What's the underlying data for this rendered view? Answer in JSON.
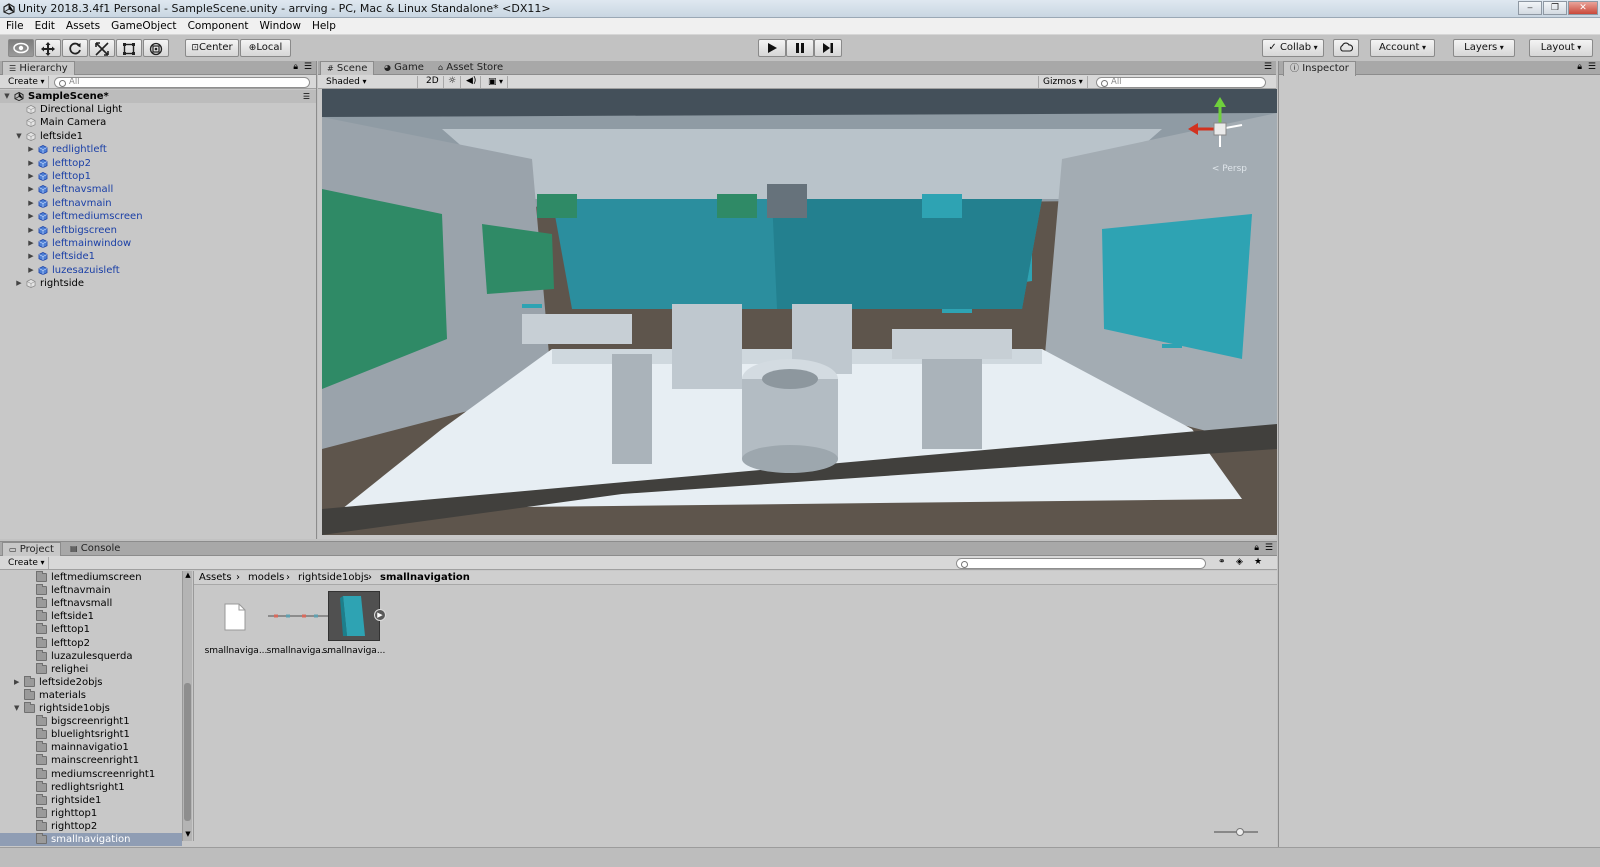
{
  "window": {
    "title": "Unity 2018.3.4f1 Personal - SampleScene.unity - arrving - PC, Mac & Linux Standalone* <DX11>",
    "controls": [
      "‒",
      "❐",
      "✕"
    ]
  },
  "menu": [
    "File",
    "Edit",
    "Assets",
    "GameObject",
    "Component",
    "Window",
    "Help"
  ],
  "toolbar": {
    "pivot": "Center",
    "space": "Local",
    "collab": "Collab",
    "account": "Account",
    "layers": "Layers",
    "layout": "Layout"
  },
  "hierarchy": {
    "tab": "Hierarchy",
    "create": "Create",
    "search_placeholder": "All",
    "scene": "SampleScene*",
    "items": [
      {
        "label": "Directional Light",
        "depth": 1,
        "arrow": "",
        "prefab": false
      },
      {
        "label": "Main Camera",
        "depth": 1,
        "arrow": "",
        "prefab": false
      },
      {
        "label": "leftside1",
        "depth": 1,
        "arrow": "▼",
        "prefab": false
      },
      {
        "label": "redlightleft",
        "depth": 2,
        "arrow": "▶",
        "prefab": true
      },
      {
        "label": "lefttop2",
        "depth": 2,
        "arrow": "▶",
        "prefab": true
      },
      {
        "label": "lefttop1",
        "depth": 2,
        "arrow": "▶",
        "prefab": true
      },
      {
        "label": "leftnavsmall",
        "depth": 2,
        "arrow": "▶",
        "prefab": true
      },
      {
        "label": "leftnavmain",
        "depth": 2,
        "arrow": "▶",
        "prefab": true
      },
      {
        "label": "leftmediumscreen",
        "depth": 2,
        "arrow": "▶",
        "prefab": true
      },
      {
        "label": "leftbigscreen",
        "depth": 2,
        "arrow": "▶",
        "prefab": true
      },
      {
        "label": "leftmainwindow",
        "depth": 2,
        "arrow": "▶",
        "prefab": true
      },
      {
        "label": "leftside1",
        "depth": 2,
        "arrow": "▶",
        "prefab": true
      },
      {
        "label": "luzesazuisleft",
        "depth": 2,
        "arrow": "▶",
        "prefab": true
      },
      {
        "label": "rightside",
        "depth": 1,
        "arrow": "▶",
        "prefab": false
      }
    ]
  },
  "scene": {
    "tabs": [
      "Scene",
      "Game",
      "Asset Store"
    ],
    "shading": "Shaded",
    "mode2d": "2D",
    "gizmos": "Gizmos",
    "search_placeholder": "All",
    "persp": "< Persp"
  },
  "inspector": {
    "tab": "Inspector"
  },
  "project": {
    "tabs": [
      "Project",
      "Console"
    ],
    "create": "Create",
    "breadcrumb": [
      "Assets",
      "models",
      "rightside1objs",
      "smallnavigation"
    ],
    "tree": [
      {
        "label": "leftmediumscreen",
        "depth": 3,
        "arrow": ""
      },
      {
        "label": "leftnavmain",
        "depth": 3,
        "arrow": ""
      },
      {
        "label": "leftnavsmall",
        "depth": 3,
        "arrow": ""
      },
      {
        "label": "leftside1",
        "depth": 3,
        "arrow": ""
      },
      {
        "label": "lefttop1",
        "depth": 3,
        "arrow": ""
      },
      {
        "label": "lefttop2",
        "depth": 3,
        "arrow": ""
      },
      {
        "label": "luzazulesquerda",
        "depth": 3,
        "arrow": ""
      },
      {
        "label": "relighei",
        "depth": 3,
        "arrow": ""
      },
      {
        "label": "leftside2objs",
        "depth": 2,
        "arrow": "▶"
      },
      {
        "label": "materials",
        "depth": 2,
        "arrow": ""
      },
      {
        "label": "rightside1objs",
        "depth": 2,
        "arrow": "▼"
      },
      {
        "label": "bigscreenright1",
        "depth": 3,
        "arrow": ""
      },
      {
        "label": "bluelightsright1",
        "depth": 3,
        "arrow": ""
      },
      {
        "label": "mainnavigatio1",
        "depth": 3,
        "arrow": ""
      },
      {
        "label": "mainscreenright1",
        "depth": 3,
        "arrow": ""
      },
      {
        "label": "mediumscreenright1",
        "depth": 3,
        "arrow": ""
      },
      {
        "label": "redlightsright1",
        "depth": 3,
        "arrow": ""
      },
      {
        "label": "rightside1",
        "depth": 3,
        "arrow": ""
      },
      {
        "label": "righttop1",
        "depth": 3,
        "arrow": ""
      },
      {
        "label": "righttop2",
        "depth": 3,
        "arrow": ""
      },
      {
        "label": "smallnavigation",
        "depth": 3,
        "arrow": "",
        "selected": true
      }
    ],
    "assets": [
      "smallnaviga...",
      "smallnaviga...",
      "smallnaviga..."
    ]
  },
  "colors": {
    "editor_bg": "#c2c2c2",
    "selection": "#8f9db4",
    "prefab_text": "#1a3fa6",
    "screen_teal": "#2ea3b3",
    "screen_green": "#2f8a66"
  }
}
